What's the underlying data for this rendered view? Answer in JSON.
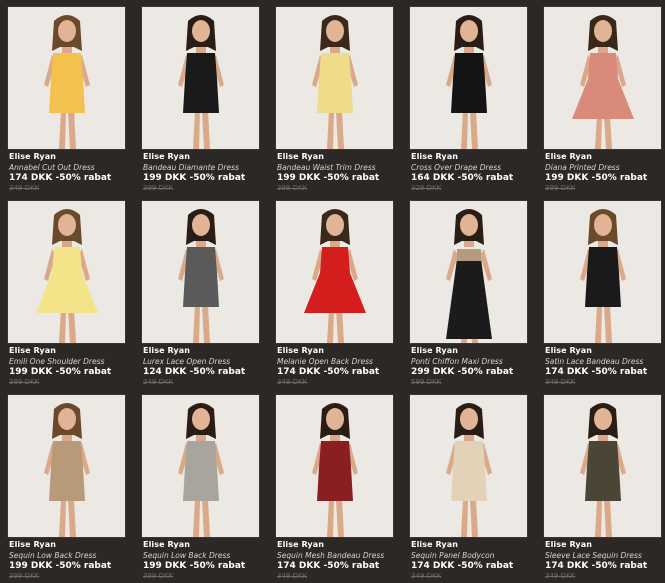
{
  "products": [
    {
      "brand": "Elise Ryan",
      "name": "Annabel Cut Out Dress",
      "price": "174 DKK",
      "discount": "-50% rabat",
      "old_price": "349 DKK",
      "dress_color": "#f2c14e",
      "hair_color": "#6b4a2b",
      "style": "short"
    },
    {
      "brand": "Elise Ryan",
      "name": "Bandeau Diamante Dress",
      "price": "199 DKK",
      "discount": "-50% rabat",
      "old_price": "399 DKK",
      "dress_color": "#1a1a1a",
      "hair_color": "#2a1d15",
      "style": "short"
    },
    {
      "brand": "Elise Ryan",
      "name": "Bandeau Waist Trim Dress",
      "price": "199 DKK",
      "discount": "-50% rabat",
      "old_price": "399 DKK",
      "dress_color": "#eedc8a",
      "hair_color": "#3a281a",
      "style": "short"
    },
    {
      "brand": "Elise Ryan",
      "name": "Cross Over Drape Dress",
      "price": "164 DKK",
      "discount": "-50% rabat",
      "old_price": "329 DKK",
      "dress_color": "#141414",
      "hair_color": "#2a1d15",
      "style": "short"
    },
    {
      "brand": "Elise Ryan",
      "name": "Diana Printed Dress",
      "price": "199 DKK",
      "discount": "-50% rabat",
      "old_price": "399 DKK",
      "dress_color": "#d98a7a",
      "hair_color": "#3a281a",
      "style": "flare"
    },
    {
      "brand": "Elise Ryan",
      "name": "Emili One Shoulder Dress",
      "price": "199 DKK",
      "discount": "-50% rabat",
      "old_price": "399 DKK",
      "dress_color": "#f3e48a",
      "hair_color": "#6b4a2b",
      "style": "flare"
    },
    {
      "brand": "Elise Ryan",
      "name": "Lurex Lace Open Dress",
      "price": "124 DKK",
      "discount": "-50% rabat",
      "old_price": "249 DKK",
      "dress_color": "#5a5a5a",
      "hair_color": "#2a1d15",
      "style": "short"
    },
    {
      "brand": "Elise Ryan",
      "name": "Melanie Open Back Dress",
      "price": "174 DKK",
      "discount": "-50% rabat",
      "old_price": "349 DKK",
      "dress_color": "#d41d1d",
      "hair_color": "#3a281a",
      "style": "flare"
    },
    {
      "brand": "Elise Ryan",
      "name": "Ponti Chiffon Maxi Dress",
      "price": "299 DKK",
      "discount": "-50% rabat",
      "old_price": "599 DKK",
      "dress_color": "#1b1b1b",
      "hair_color": "#2a1d15",
      "style": "maxi"
    },
    {
      "brand": "Elise Ryan",
      "name": "Satin Lace Bandeau Dress",
      "price": "174 DKK",
      "discount": "-50% rabat",
      "old_price": "349 DKK",
      "dress_color": "#1a1a1a",
      "hair_color": "#6b4a2b",
      "style": "short"
    },
    {
      "brand": "Elise Ryan",
      "name": "Sequin Low Back Dress",
      "price": "199 DKK",
      "discount": "-50% rabat",
      "old_price": "399 DKK",
      "dress_color": "#b89a78",
      "hair_color": "#6b4a2b",
      "style": "short"
    },
    {
      "brand": "Elise Ryan",
      "name": "Sequin Low Back Dress",
      "price": "199 DKK",
      "discount": "-50% rabat",
      "old_price": "399 DKK",
      "dress_color": "#a9a59c",
      "hair_color": "#2a1d15",
      "style": "short"
    },
    {
      "brand": "Elise Ryan",
      "name": "Sequin Mesh Bandeau Dress",
      "price": "174 DKK",
      "discount": "-50% rabat",
      "old_price": "349 DKK",
      "dress_color": "#8a1f22",
      "hair_color": "#2a1d15",
      "style": "short"
    },
    {
      "brand": "Elise Ryan",
      "name": "Sequin Panel Bodycon",
      "price": "174 DKK",
      "discount": "-50% rabat",
      "old_price": "349 DKK",
      "dress_color": "#e2d3b8",
      "hair_color": "#2a1d15",
      "style": "short"
    },
    {
      "brand": "Elise Ryan",
      "name": "Sleeve Lace Sequin Dress",
      "price": "174 DKK",
      "discount": "-50% rabat",
      "old_price": "349 DKK",
      "dress_color": "#4a4534",
      "hair_color": "#2a1d15",
      "style": "short"
    }
  ]
}
